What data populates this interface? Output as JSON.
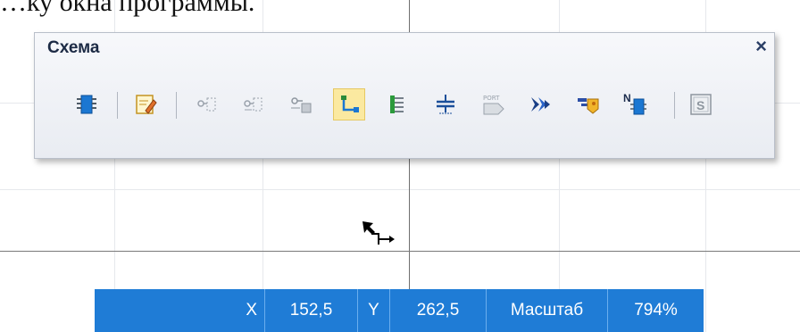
{
  "caption_fragment": "…ку окна программы.",
  "panel": {
    "title": "Схема",
    "close_glyph": "×",
    "buttons": [
      {
        "name": "chip-icon"
      },
      {
        "name": "edit-sheet-icon"
      },
      {
        "name": "pin-dotted-icon"
      },
      {
        "name": "pin-dotted-2-icon"
      },
      {
        "name": "pin-group-icon"
      },
      {
        "name": "wire-icon",
        "active": true
      },
      {
        "name": "bus-icon"
      },
      {
        "name": "ground-icon"
      },
      {
        "name": "port-icon",
        "text": "PORT"
      },
      {
        "name": "arrows-icon"
      },
      {
        "name": "transfer-icon"
      },
      {
        "name": "net-label-icon",
        "text": "N"
      },
      {
        "name": "s-box-icon",
        "text": "S"
      }
    ]
  },
  "statusbar": {
    "x_label": "X",
    "x_value": "152,5",
    "y_label": "Y",
    "y_value": "262,5",
    "scale_label": "Масштаб",
    "scale_value": "794%"
  },
  "colors": {
    "status_bg": "#1f7cd6",
    "active_button": "#fbe9a0"
  }
}
